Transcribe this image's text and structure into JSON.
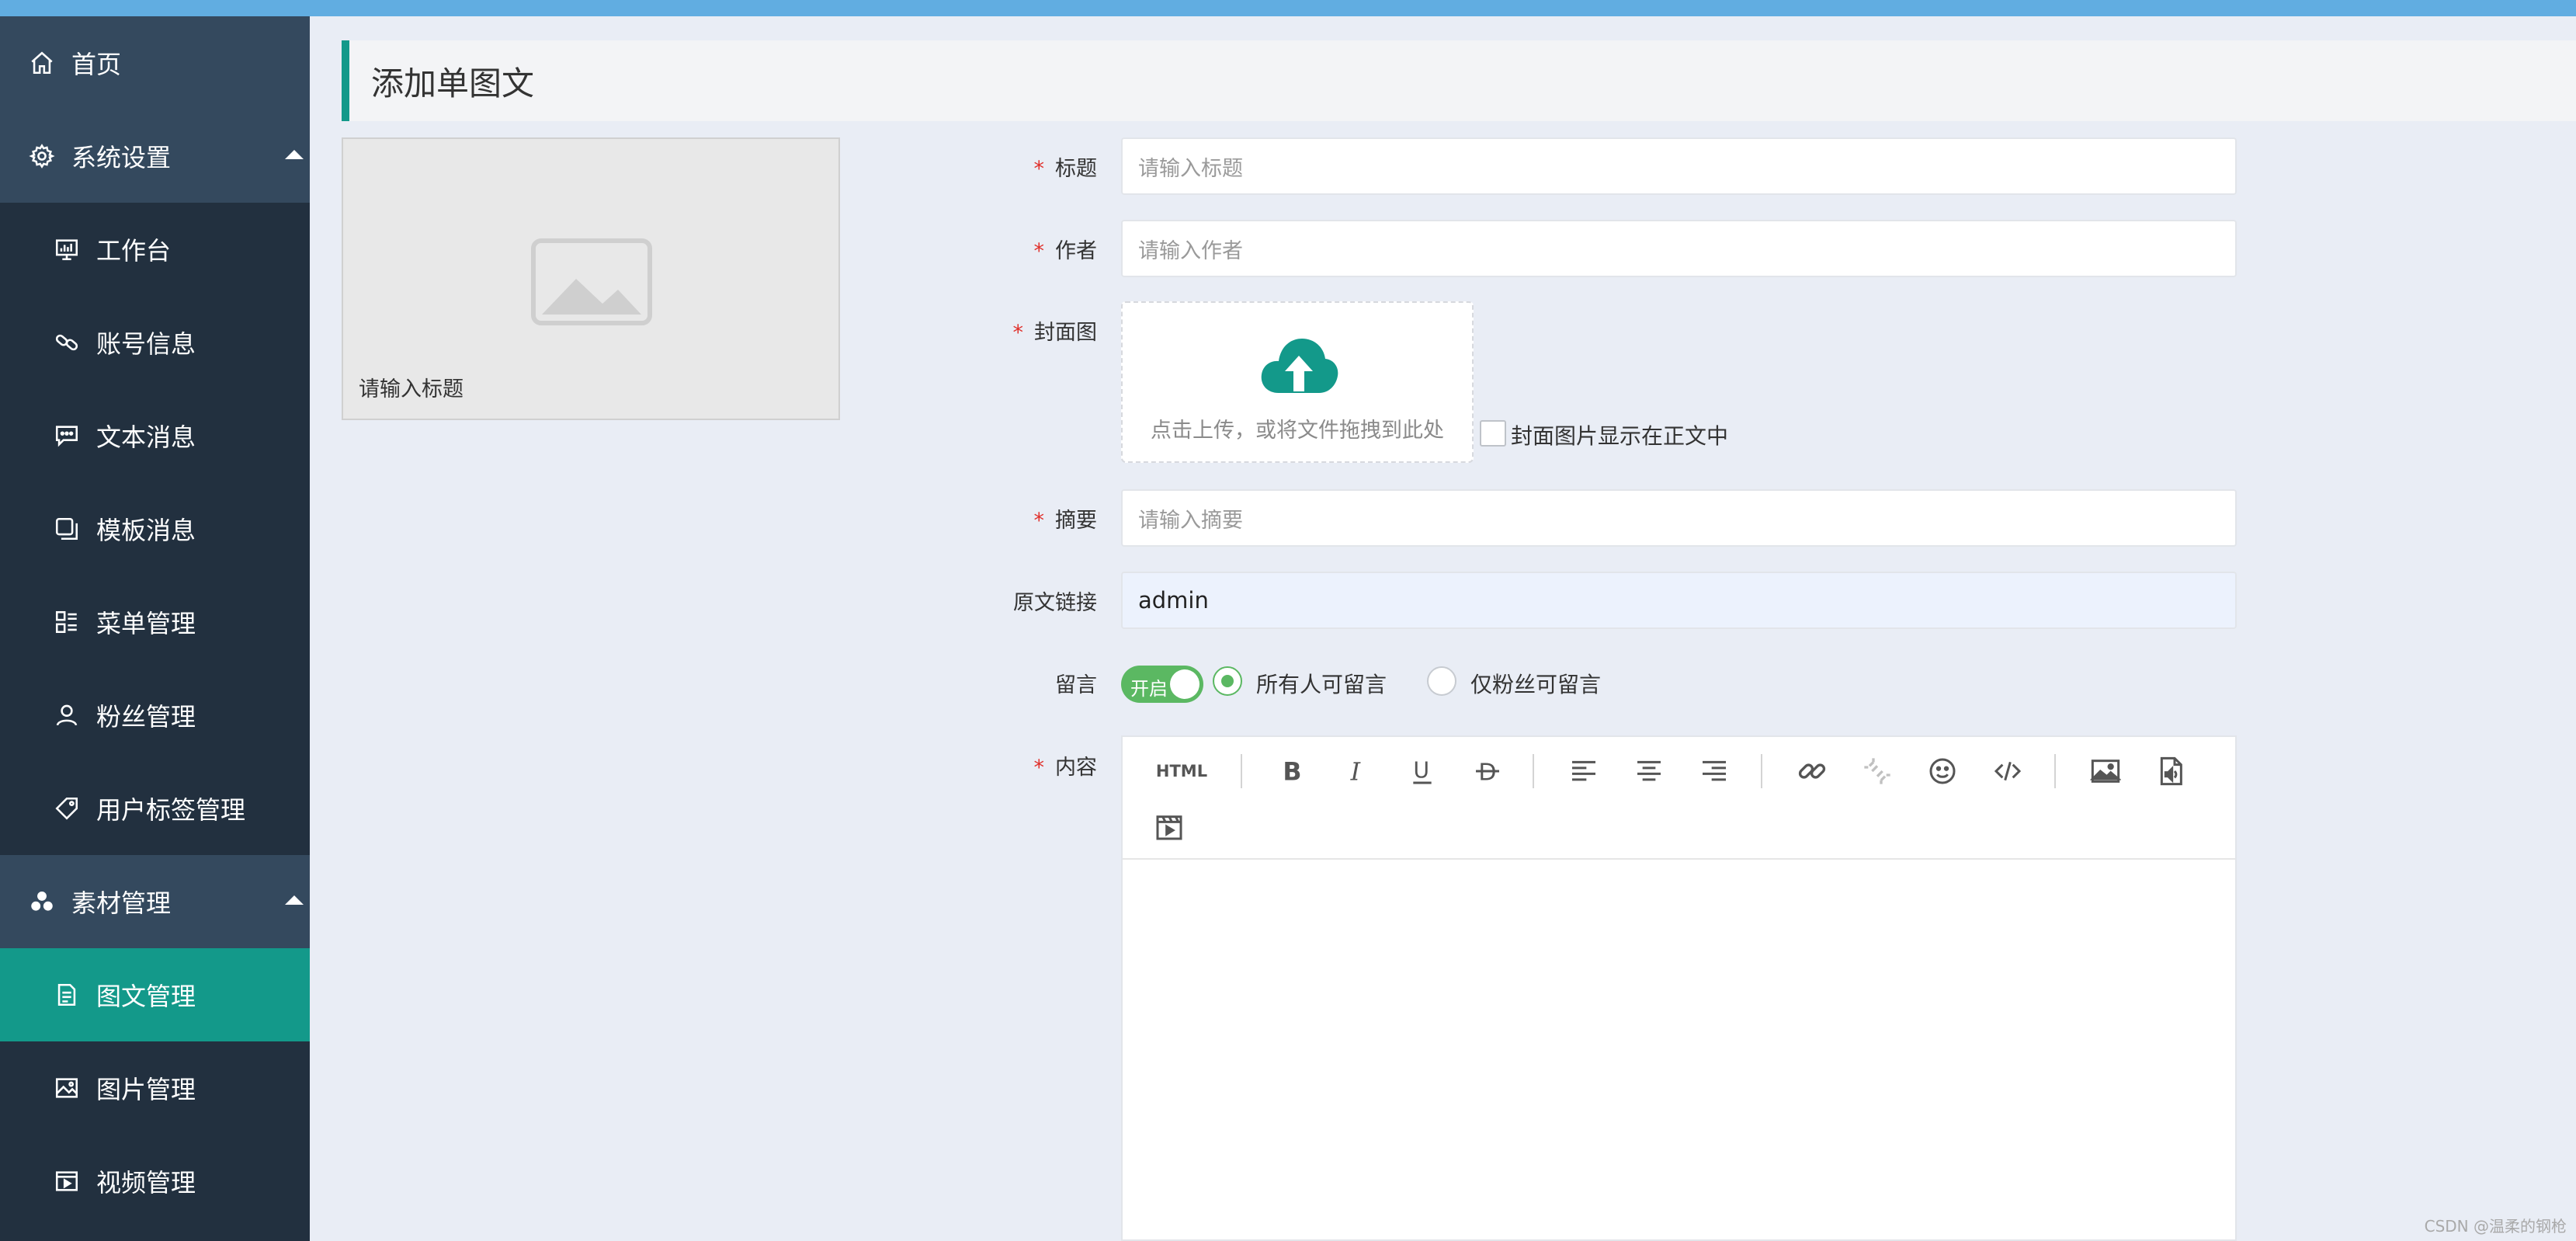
{
  "sidebar": {
    "items": [
      {
        "label": "首页",
        "icon": "home-icon",
        "level": "top"
      },
      {
        "label": "系统设置",
        "icon": "gear-icon",
        "level": "top",
        "expanded": true
      },
      {
        "label": "工作台",
        "icon": "dashboard-icon",
        "level": "sub"
      },
      {
        "label": "账号信息",
        "icon": "link-icon",
        "level": "sub"
      },
      {
        "label": "文本消息",
        "icon": "message-icon",
        "level": "sub"
      },
      {
        "label": "模板消息",
        "icon": "template-icon",
        "level": "sub"
      },
      {
        "label": "菜单管理",
        "icon": "menu-icon",
        "level": "sub"
      },
      {
        "label": "粉丝管理",
        "icon": "user-icon",
        "level": "sub"
      },
      {
        "label": "用户标签管理",
        "icon": "tag-icon",
        "level": "sub"
      },
      {
        "label": "素材管理",
        "icon": "materials-icon",
        "level": "top",
        "expanded": true
      },
      {
        "label": "图文管理",
        "icon": "article-icon",
        "level": "sub",
        "active": true
      },
      {
        "label": "图片管理",
        "icon": "image-icon",
        "level": "sub"
      },
      {
        "label": "视频管理",
        "icon": "video-icon",
        "level": "sub"
      }
    ]
  },
  "page": {
    "title": "添加单图文"
  },
  "preview": {
    "title": "请输入标题"
  },
  "form": {
    "title": {
      "label": "标题",
      "required": true,
      "placeholder": "请输入标题"
    },
    "author": {
      "label": "作者",
      "required": true,
      "placeholder": "请输入作者"
    },
    "cover": {
      "label": "封面图",
      "required": true,
      "upload_text": "点击上传，或将文件拖拽到此处",
      "checkbox_label": "封面图片显示在正文中",
      "checkbox_checked": false
    },
    "summary": {
      "label": "摘要",
      "required": true,
      "placeholder": "请输入摘要"
    },
    "source_link": {
      "label": "原文链接",
      "required": false,
      "value": "admin"
    },
    "comment": {
      "label": "留言",
      "switch_text": "开启",
      "switch_on": true,
      "options": [
        "所有人可留言",
        "仅粉丝可留言"
      ],
      "selected": 0
    },
    "content": {
      "label": "内容",
      "required": true
    }
  },
  "editor": {
    "toolbar": [
      {
        "name": "html-button",
        "text": "HTML"
      },
      {
        "name": "bold-button",
        "icon": "bold-icon"
      },
      {
        "name": "italic-button",
        "icon": "italic-icon"
      },
      {
        "name": "underline-button",
        "icon": "underline-icon"
      },
      {
        "name": "strikethrough-button",
        "icon": "strikethrough-icon"
      },
      {
        "name": "align-left-button",
        "icon": "align-left-icon"
      },
      {
        "name": "align-center-button",
        "icon": "align-center-icon"
      },
      {
        "name": "align-right-button",
        "icon": "align-right-icon"
      },
      {
        "name": "insert-link-button",
        "icon": "link-icon"
      },
      {
        "name": "unlink-button",
        "icon": "unlink-icon"
      },
      {
        "name": "emoji-button",
        "icon": "emoji-icon"
      },
      {
        "name": "code-button",
        "icon": "code-icon"
      },
      {
        "name": "insert-image-button",
        "icon": "image-icon"
      },
      {
        "name": "insert-audio-button",
        "icon": "audio-file-icon"
      },
      {
        "name": "insert-video-button",
        "icon": "video-icon"
      }
    ]
  },
  "colors": {
    "accent": "#13998a",
    "sidebar_bg": "#22303f",
    "sidebar_top_bg": "#34495e",
    "topbar": "#61ade1",
    "required": "#e0302b",
    "switch_green": "#5bb862"
  },
  "watermark": "CSDN @温柔的钢枪"
}
